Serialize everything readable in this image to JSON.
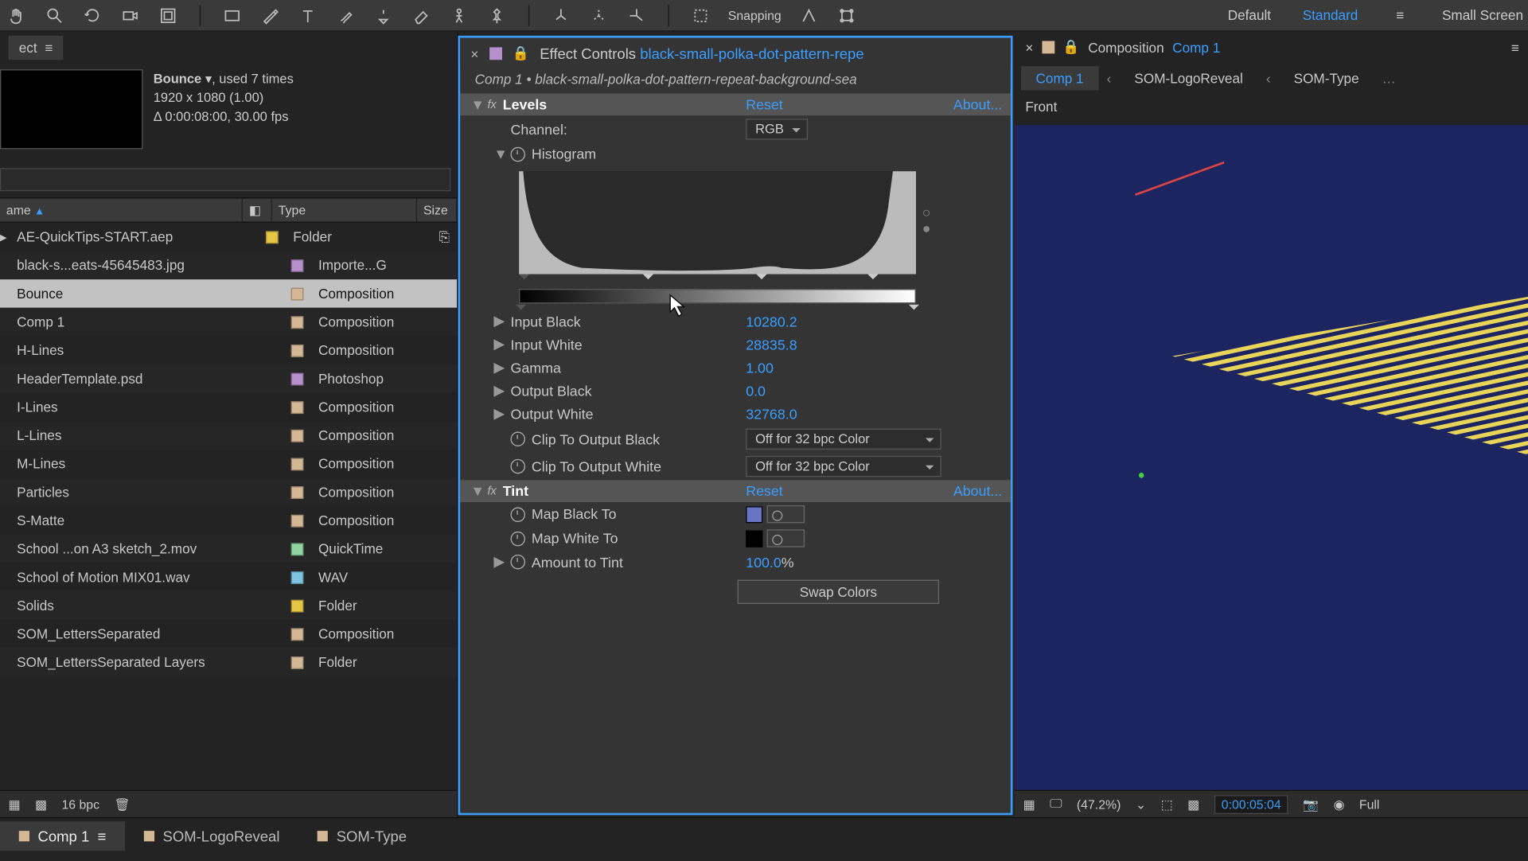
{
  "toolbar": {
    "snapping": "Snapping",
    "workspaces": [
      "Default",
      "Standard",
      "Small Screen"
    ],
    "active_workspace": "Standard"
  },
  "project": {
    "tab": "ect",
    "info_name": "Bounce",
    "info_used": ", used 7 times",
    "info_dims": "1920 x 1080 (1.00)",
    "info_dur": "Δ 0:00:08:00, 30.00 fps",
    "search_placeholder": "",
    "headers": {
      "name": "ame",
      "type": "Type",
      "size": "Size"
    },
    "items": [
      {
        "name": "AE-QuickTips-START.aep",
        "type": "Folder",
        "color": "#e5c544",
        "folder": true
      },
      {
        "name": "black-s...eats-45645483.jpg",
        "type": "Importe...G",
        "color": "#b68fcd"
      },
      {
        "name": "Bounce",
        "type": "Composition",
        "color": "#d4b896",
        "selected": true
      },
      {
        "name": "Comp 1",
        "type": "Composition",
        "color": "#d4b896"
      },
      {
        "name": "H-Lines",
        "type": "Composition",
        "color": "#d4b896"
      },
      {
        "name": "HeaderTemplate.psd",
        "type": "Photoshop",
        "color": "#b68fcd"
      },
      {
        "name": "I-Lines",
        "type": "Composition",
        "color": "#d4b896"
      },
      {
        "name": "L-Lines",
        "type": "Composition",
        "color": "#d4b896"
      },
      {
        "name": "M-Lines",
        "type": "Composition",
        "color": "#d4b896"
      },
      {
        "name": "Particles",
        "type": "Composition",
        "color": "#d4b896"
      },
      {
        "name": "S-Matte",
        "type": "Composition",
        "color": "#d4b896"
      },
      {
        "name": "School ...on A3 sketch_2.mov",
        "type": "QuickTime",
        "color": "#8fd4a0"
      },
      {
        "name": "School of Motion MIX01.wav",
        "type": "WAV",
        "color": "#7cc4e0"
      },
      {
        "name": "Solids",
        "type": "Folder",
        "color": "#e5c544"
      },
      {
        "name": "SOM_LettersSeparated",
        "type": "Composition",
        "color": "#d4b896"
      },
      {
        "name": "SOM_LettersSeparated Layers",
        "type": "Folder",
        "color": "#d4b896"
      }
    ],
    "bpc": "16 bpc"
  },
  "effect": {
    "panel_label": "Effect Controls",
    "asset": "black-small-polka-dot-pattern-repe",
    "path": "Comp 1 • black-small-polka-dot-pattern-repeat-background-sea",
    "levels": {
      "title": "Levels",
      "reset": "Reset",
      "about": "About...",
      "channel_label": "Channel:",
      "channel_value": "RGB",
      "histogram_label": "Histogram",
      "input_black_label": "Input Black",
      "input_black": "10280.2",
      "input_white_label": "Input White",
      "input_white": "28835.8",
      "gamma_label": "Gamma",
      "gamma": "1.00",
      "output_black_label": "Output Black",
      "output_black": "0.0",
      "output_white_label": "Output White",
      "output_white": "32768.0",
      "clip_black_label": "Clip To Output Black",
      "clip_black": "Off for 32 bpc Color",
      "clip_white_label": "Clip To Output White",
      "clip_white": "Off for 32 bpc Color"
    },
    "tint": {
      "title": "Tint",
      "reset": "Reset",
      "about": "About...",
      "map_black_label": "Map Black To",
      "map_black_color": "#6874c4",
      "map_white_label": "Map White To",
      "map_white_color": "#000000",
      "amount_label": "Amount to Tint",
      "amount": "100.0",
      "amount_suffix": "%",
      "swap": "Swap Colors"
    }
  },
  "composition": {
    "label": "Composition",
    "name": "Comp 1",
    "tabs": [
      "Comp 1",
      "SOM-LogoReveal",
      "SOM-Type"
    ],
    "front": "Front",
    "zoom": "(47.2%)",
    "timecode": "0:00:05:04",
    "res": "Full"
  },
  "timeline": {
    "tabs": [
      {
        "label": "Comp 1",
        "color": "#d4b896",
        "on": true
      },
      {
        "label": "SOM-LogoReveal",
        "color": "#d4b896"
      },
      {
        "label": "SOM-Type",
        "color": "#d4b896"
      }
    ]
  }
}
